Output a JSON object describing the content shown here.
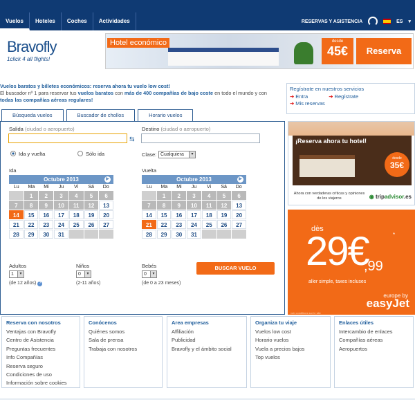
{
  "nav": {
    "tabs": [
      {
        "label": "Vuelos"
      },
      {
        "label": "Hoteles"
      },
      {
        "label": "Coches"
      },
      {
        "label": "Actividades"
      }
    ],
    "reservas": "RESERVAS Y ASISTENCIA",
    "lang": "ES"
  },
  "logo": {
    "brand_a": "Bravo",
    "brand_b": "fly",
    "tagline": "1click 4 all flights!"
  },
  "banner": {
    "label": "Hotel económico",
    "desde": "desde",
    "price": "45€",
    "cta": "Reserva"
  },
  "intro": {
    "lead": "Vuelos baratos y billetes económicos: reserva ahora tu vuelo low cost!",
    "l1a": "El buscador nº 1 para reservar tus ",
    "l1b": "vuelos baratos",
    "l1c": " con ",
    "l1d": "más de 400 compañías de bajo coste",
    "l1e": " en todo el mundo y con",
    "l2": "todas las compañías aéreas regulares!"
  },
  "register": {
    "title": "Regístrate en nuestros servicios",
    "entra": "Entra",
    "registrate": "Regístrate",
    "reservas": "Mis reservas"
  },
  "search": {
    "tabs": [
      {
        "label": "Búsqueda vuelos"
      },
      {
        "label": "Buscador de chollos"
      },
      {
        "label": "Horario vuelos"
      }
    ],
    "salida": "Salida",
    "salida_hint": "(ciudad o aeropuerto)",
    "destino": "Destino",
    "destino_hint": "(ciudad o aeropuerto)",
    "ida_vuelta": "Ida y vuelta",
    "solo_ida": "Sólo ida",
    "clase": "Clase:",
    "clase_value": "Cualquiera",
    "ida": "Ida",
    "vuelta": "Vuelta",
    "month": "Octubre 2013",
    "dow": [
      "Lu",
      "Ma",
      "Mi",
      "Ju",
      "Vi",
      "Sá",
      "Do"
    ],
    "adultos": "Adultos",
    "adultos_val": "1",
    "adultos_hint": "(de 12 años)",
    "ninos": "Niños",
    "ninos_val": "0",
    "ninos_hint": "(2-11 años)",
    "bebes": "Bebés",
    "bebes_val": "0",
    "bebes_hint": "(de 0 a 23 meses)",
    "button": "BUSCAR VUELO"
  },
  "trip": {
    "title": "¡Reserva ahora tu hotel!",
    "desde": "desde",
    "price": "35€",
    "caption": "Ahora con verdaderas críticas y opiniones de los viajeros",
    "ta_a": "trip",
    "ta_b": "advisor",
    "ta_c": ".es"
  },
  "easyjet": {
    "des": "dès",
    "big": "29€",
    "cents": ",99",
    "ast": "*",
    "fine": "aller simple, taxes incluses",
    "eb": "europe by",
    "logo": "easyJet",
    "cond": "voir conditions sur le site"
  },
  "footer": [
    {
      "title": "Reserva con nosotros",
      "items": [
        "Ventajas con Bravofly",
        "Centro de Asistencia",
        "Preguntas frecuentes",
        "Info Compañías",
        "Reserva seguro",
        "Condiciones de uso",
        "Información sobre cookies"
      ]
    },
    {
      "title": "Conócenos",
      "items": [
        "Quiénes somos",
        "Sala de prensa",
        "Trabaja con nosotros"
      ]
    },
    {
      "title": "Area empresas",
      "items": [
        "Affiliación",
        "Publicidad",
        "Bravofly y el ámbito social"
      ]
    },
    {
      "title": "Organiza tu viaje",
      "items": [
        "Vuelos low cost",
        "Horario vuelos",
        "Vuela a precios bajos",
        "Top vuelos"
      ]
    },
    {
      "title": "Enlaces útiles",
      "items": [
        "Intercambio de enlaces",
        "Compañías aéreas",
        "Aeropuertos"
      ]
    }
  ],
  "colors": {
    "nav": "#0f3a73",
    "accent": "#f26a17",
    "link": "#1f5d9b",
    "calendar_header": "#6c96c6"
  }
}
